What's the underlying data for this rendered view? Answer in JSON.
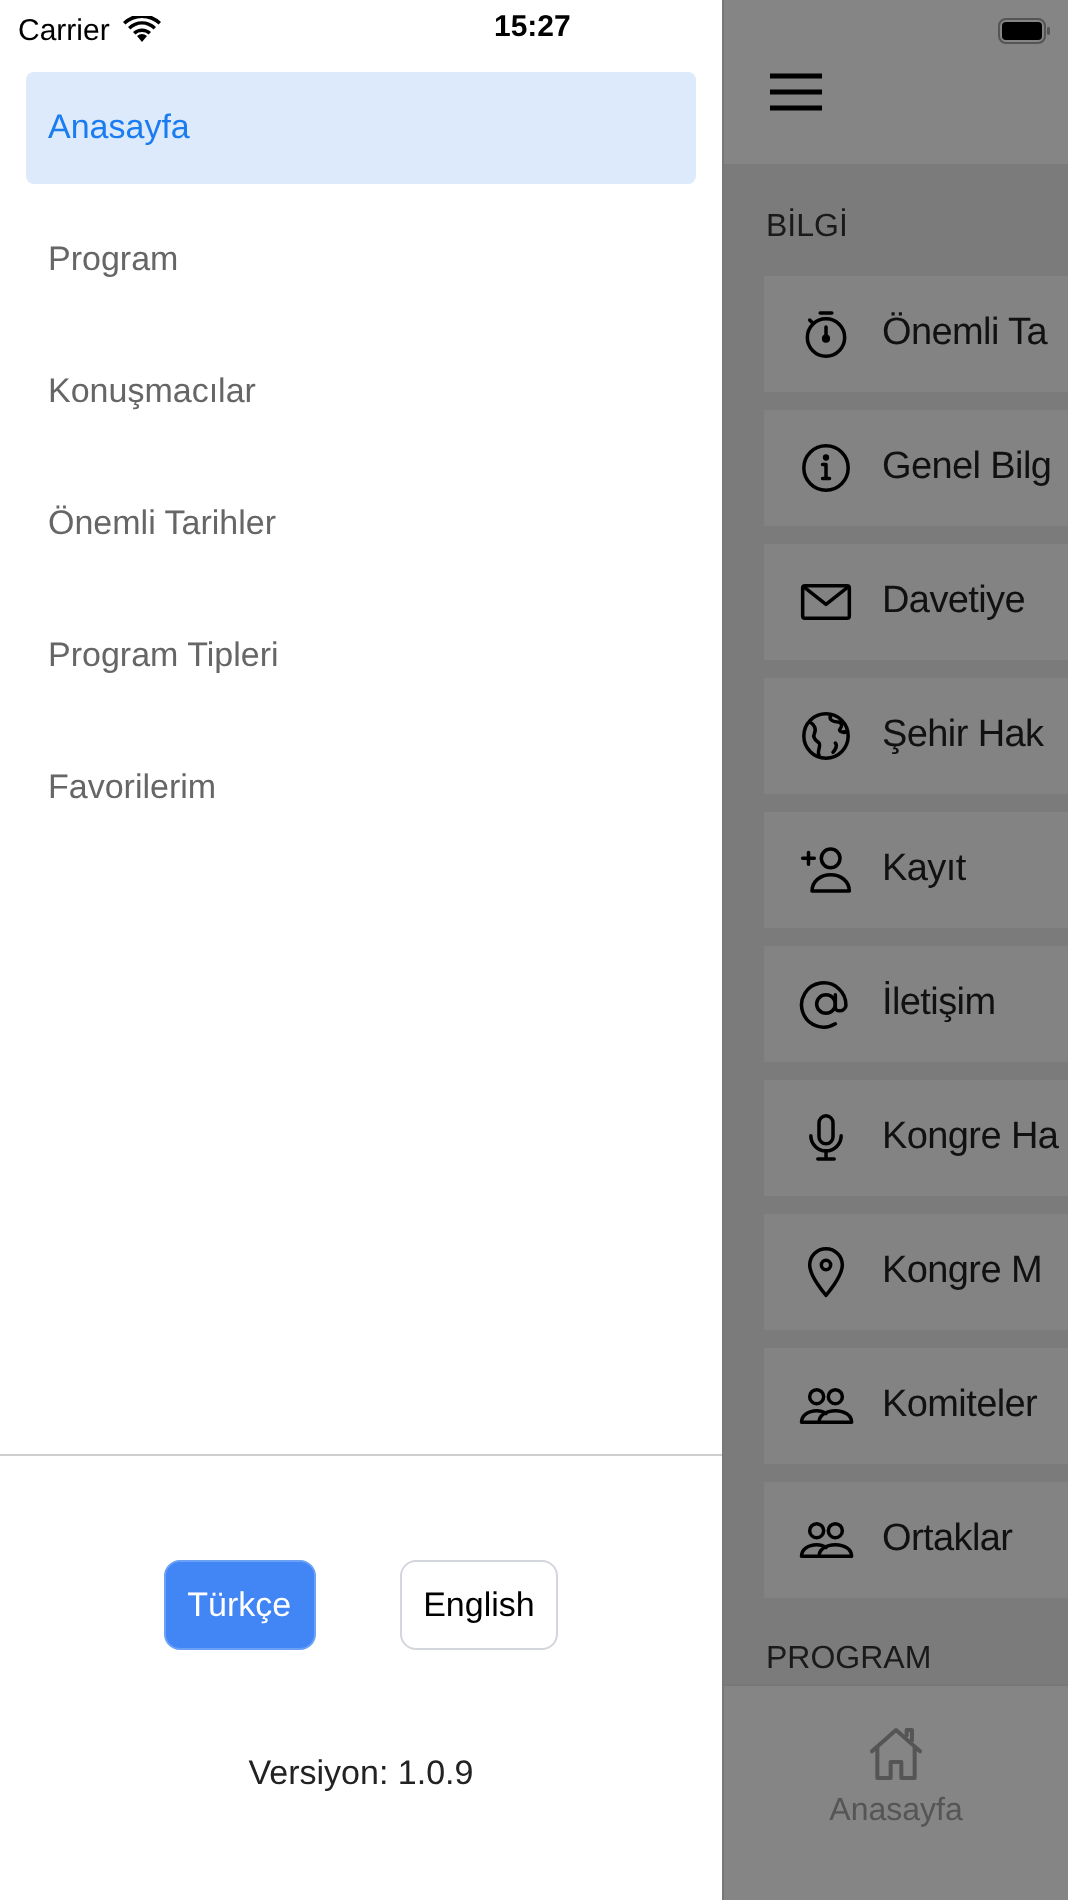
{
  "status_bar": {
    "carrier": "Carrier",
    "time": "15:27"
  },
  "drawer": {
    "items": [
      {
        "label": "Anasayfa",
        "selected": true
      },
      {
        "label": "Program",
        "selected": false
      },
      {
        "label": "Konuşmacılar",
        "selected": false
      },
      {
        "label": "Önemli Tarihler",
        "selected": false
      },
      {
        "label": "Program Tipleri",
        "selected": false
      },
      {
        "label": "Favorilerim",
        "selected": false
      }
    ],
    "languages": [
      {
        "label": "Türkçe",
        "selected": true
      },
      {
        "label": "English",
        "selected": false
      }
    ],
    "version": "Versiyon: 1.0.9"
  },
  "main": {
    "sections": [
      {
        "title": "BİLGİ",
        "items": [
          {
            "label": "Önemli Ta",
            "kind": "stopwatch"
          },
          {
            "label": "Genel Bilg",
            "kind": "info"
          },
          {
            "label": "Davetiye",
            "kind": "mail"
          },
          {
            "label": "Şehir Hak",
            "kind": "globe"
          },
          {
            "label": "Kayıt",
            "kind": "add-person"
          },
          {
            "label": "İletişim",
            "kind": "at"
          },
          {
            "label": "Kongre Ha",
            "kind": "mic"
          },
          {
            "label": "Kongre M",
            "kind": "pin"
          },
          {
            "label": "Komiteler",
            "kind": "people"
          },
          {
            "label": "Ortaklar",
            "kind": "people"
          }
        ]
      },
      {
        "title": "PROGRAM"
      }
    ]
  },
  "tab_bar": {
    "tabs": [
      {
        "label": "Anasayfa",
        "kind": "home"
      }
    ]
  }
}
